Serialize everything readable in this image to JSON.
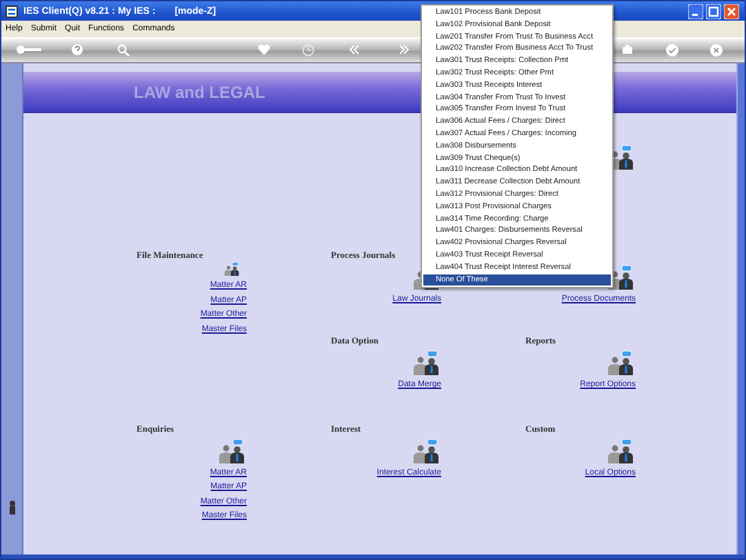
{
  "window": {
    "title": "IES Client(Q) v8.21 : My IES :",
    "mode": "[mode-Z]"
  },
  "menu": [
    "Help",
    "Submit",
    "Quit",
    "Functions",
    "Commands"
  ],
  "banner": {
    "title": "LAW and LEGAL"
  },
  "rows": [
    [
      {
        "kind": "blank"
      },
      {
        "kind": "blank"
      },
      {
        "kind": "icon"
      }
    ],
    [
      {
        "kind": "section",
        "title": "File Maintenance",
        "links": [
          "Matter AR",
          "Matter AP",
          "Matter Other",
          "Master Files"
        ]
      },
      {
        "kind": "section",
        "title": "Process Journals",
        "links": [
          "Law Journals"
        ]
      },
      {
        "kind": "section",
        "links": [
          "Process Documents"
        ]
      }
    ],
    [
      {
        "kind": "blank"
      },
      {
        "kind": "section",
        "title": "Data Option",
        "links": [
          "Data Merge"
        ]
      },
      {
        "kind": "section",
        "title": "Reports",
        "links": [
          "Report Options"
        ]
      }
    ],
    [
      {
        "kind": "section",
        "title": "Enquiries",
        "links": [
          "Matter AR",
          "Matter AP",
          "Matter Other",
          "Master Files"
        ]
      },
      {
        "kind": "section",
        "title": "Interest",
        "links": [
          "Interest Calculate"
        ]
      },
      {
        "kind": "section",
        "title": "Custom",
        "links": [
          "Local Options"
        ]
      }
    ]
  ],
  "dropdown": {
    "items": [
      {
        "label": "Law101 Process Bank Deposit",
        "selected": false
      },
      {
        "label": "Law102 Provisional Bank Deposit",
        "selected": false
      },
      {
        "label": "Law201 Transfer From Trust To Business Acct",
        "selected": false
      },
      {
        "label": "Law202 Transfer From Business Acct To Trust",
        "selected": false
      },
      {
        "label": "Law301 Trust Receipts: Collection Pmt",
        "selected": false
      },
      {
        "label": "Law302 Trust Receipts: Other Pmt",
        "selected": false
      },
      {
        "label": "Law303 Trust Receipts Interest",
        "selected": false
      },
      {
        "label": "Law304 Transfer From Trust To Invest",
        "selected": false
      },
      {
        "label": "Law305 Transfer From Invest To Trust",
        "selected": false
      },
      {
        "label": "Law306 Actual Fees / Charges: Direct",
        "selected": false
      },
      {
        "label": "Law307 Actual Fees / Charges: Incoming",
        "selected": false
      },
      {
        "label": "Law308 Disbursements",
        "selected": false
      },
      {
        "label": "Law309 Trust Cheque(s)",
        "selected": false
      },
      {
        "label": "Law310 Increase Collection Debt Amount",
        "selected": false
      },
      {
        "label": "Law311 Decrease Collection Debt Amount",
        "selected": false
      },
      {
        "label": "Law312 Provisional Charges: Direct",
        "selected": false
      },
      {
        "label": "Law313 Post Provisional Charges",
        "selected": false
      },
      {
        "label": "Law314 Time Recording: Charge",
        "selected": false
      },
      {
        "label": "Law401 Charges: Disbursements Reversal",
        "selected": false
      },
      {
        "label": "Law402 Provisional Charges Reversal",
        "selected": false
      },
      {
        "label": "Law403 Trust Receipt Reversal",
        "selected": false
      },
      {
        "label": "Law404 Trust Receipt Interest Reversal",
        "selected": false
      },
      {
        "label": "None Of These",
        "selected": true
      }
    ]
  }
}
